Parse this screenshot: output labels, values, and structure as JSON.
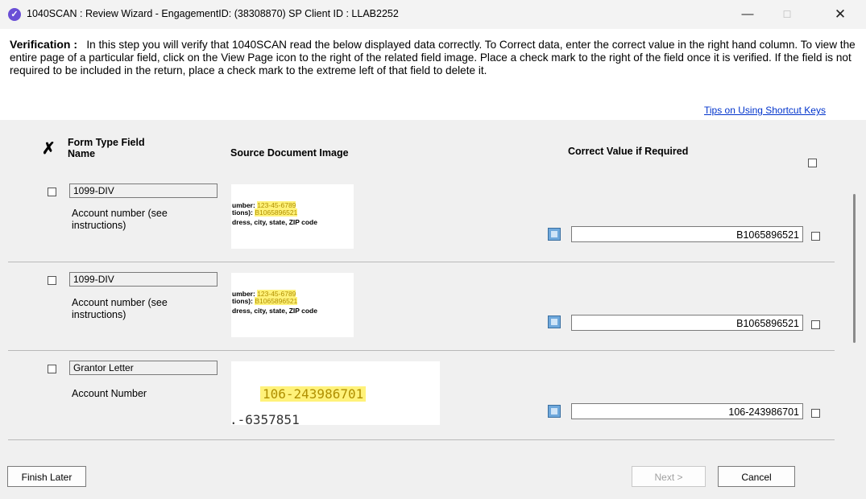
{
  "window": {
    "title": "1040SCAN : Review Wizard - EngagementID: (38308870)  SP Client ID : LLAB2252",
    "minimize_glyph": "—",
    "maximize_glyph": "☐",
    "close_glyph": "✕",
    "app_icon": "check-circle-icon"
  },
  "intro": {
    "heading": "Verification :",
    "text": "In this step you will verify that 1040SCAN read the below displayed data correctly. To Correct data, enter the correct value in the right hand column. To view the entire page of a particular field, click on the View Page icon to the right of the related field image. Place a check mark to the right of the field once it is verified. If the field is not required to be included in the return, place a check mark to the extreme left of that field to delete it.",
    "tips_link": "Tips on Using Shortcut Keys"
  },
  "columns": {
    "delete_glyph": "✗",
    "form_type_field_name": "Form Type Field Name",
    "source_document_image": "Source Document Image",
    "correct_value": "Correct Value if Required"
  },
  "rows": [
    {
      "form_type": "1099-DIV",
      "field_name": "Account number (see instructions)",
      "image": {
        "line1_label": "umber:",
        "line1_value": "123-45-6789",
        "line2_label": "tions):",
        "line2_value": "B1065896521",
        "line3": "dress, city, state, ZIP code"
      },
      "value": "B1065896521"
    },
    {
      "form_type": "1099-DIV",
      "field_name": "Account number (see instructions)",
      "image": {
        "line1_label": "umber:",
        "line1_value": "123-45-6789",
        "line2_label": "tions):",
        "line2_value": "B1065896521",
        "line3": "dress, city, state, ZIP code"
      },
      "value": "B1065896521"
    },
    {
      "form_type": "Grantor Letter",
      "field_name": "Account Number",
      "image": {
        "big_value": "106-243986701",
        "big_second": ".-6357851"
      },
      "value": "106-243986701"
    }
  ],
  "footer": {
    "finish_later": "Finish Later",
    "next": "Next >",
    "cancel": "Cancel"
  }
}
